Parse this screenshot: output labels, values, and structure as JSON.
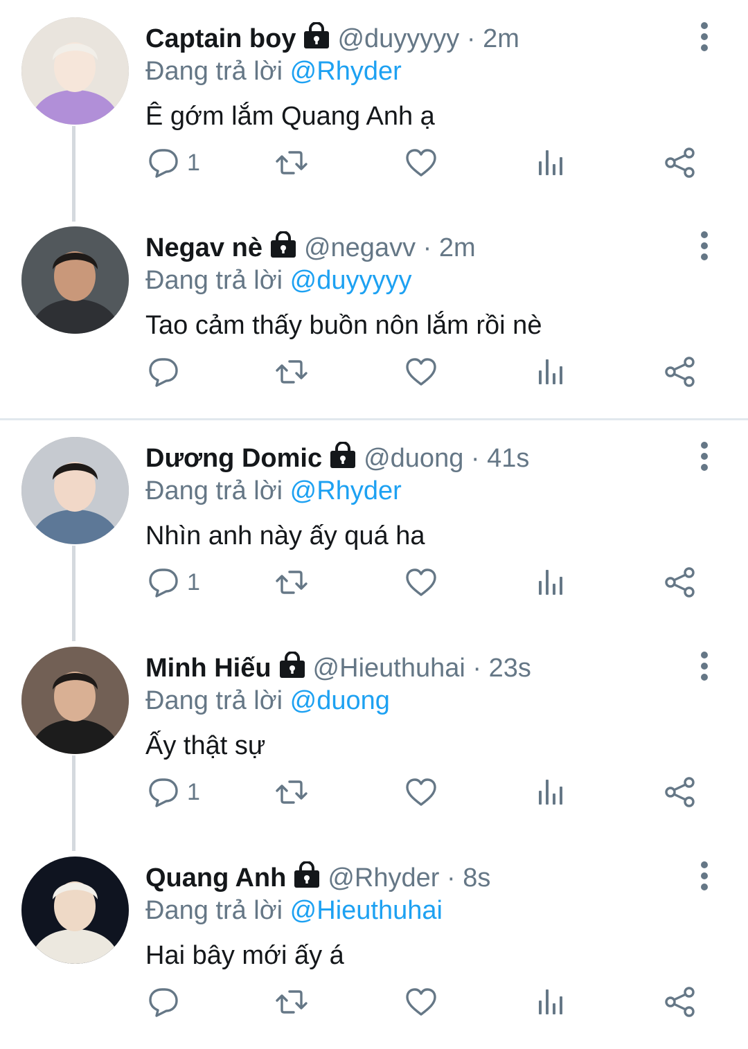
{
  "colors": {
    "handle_gray": "#657786",
    "link_blue": "#1da1f2",
    "text_dark": "#14171a",
    "divider": "#e1e8ed"
  },
  "tweets": [
    {
      "name": "Captain boy",
      "handle": "@duyyyyy",
      "time": "2m",
      "reply_prefix": "Đang trả lời",
      "reply_to": "@Rhyder",
      "text": "Ê gớm lắm Quang Anh ạ",
      "reply_count": "1",
      "avatar_colors": [
        "#e9e4dd",
        "#f6e6da",
        "#b18fd8"
      ],
      "icons": [
        "reply-icon",
        "retweet-icon",
        "like-icon",
        "analytics-icon",
        "share-icon",
        "lock-icon",
        "more-icon"
      ]
    },
    {
      "name": "Negav nè",
      "handle": "@negavv",
      "time": "2m",
      "reply_prefix": "Đang trả lời",
      "reply_to": "@duyyyyy",
      "text": "Tao cảm thấy buồn nôn lắm rồi nè",
      "reply_count": "",
      "avatar_colors": [
        "#52585c",
        "#c9987a",
        "#2e3034"
      ]
    },
    {
      "name": "Dương Domic",
      "handle": "@duong",
      "time": "41s",
      "reply_prefix": "Đang trả lời",
      "reply_to": "@Rhyder",
      "text": "Nhìn anh này ấy quá ha",
      "reply_count": "1",
      "avatar_colors": [
        "#c6cad0",
        "#f1d8c8",
        "#5d7897"
      ]
    },
    {
      "name": "Minh Hiếu",
      "handle": "@Hieuthuhai",
      "time": "23s",
      "reply_prefix": "Đang trả lời",
      "reply_to": "@duong",
      "text": "Ấy thật sự",
      "reply_count": "1",
      "avatar_colors": [
        "#726055",
        "#d9b094",
        "#1c1c1c"
      ]
    },
    {
      "name": "Quang Anh",
      "handle": "@Rhyder",
      "time": "8s",
      "reply_prefix": "Đang trả lời",
      "reply_to": "@Hieuthuhai",
      "text": "Hai bây mới ấy á",
      "reply_count": "",
      "avatar_colors": [
        "#0f1420",
        "#eed9c6",
        "#ece8df"
      ]
    }
  ]
}
